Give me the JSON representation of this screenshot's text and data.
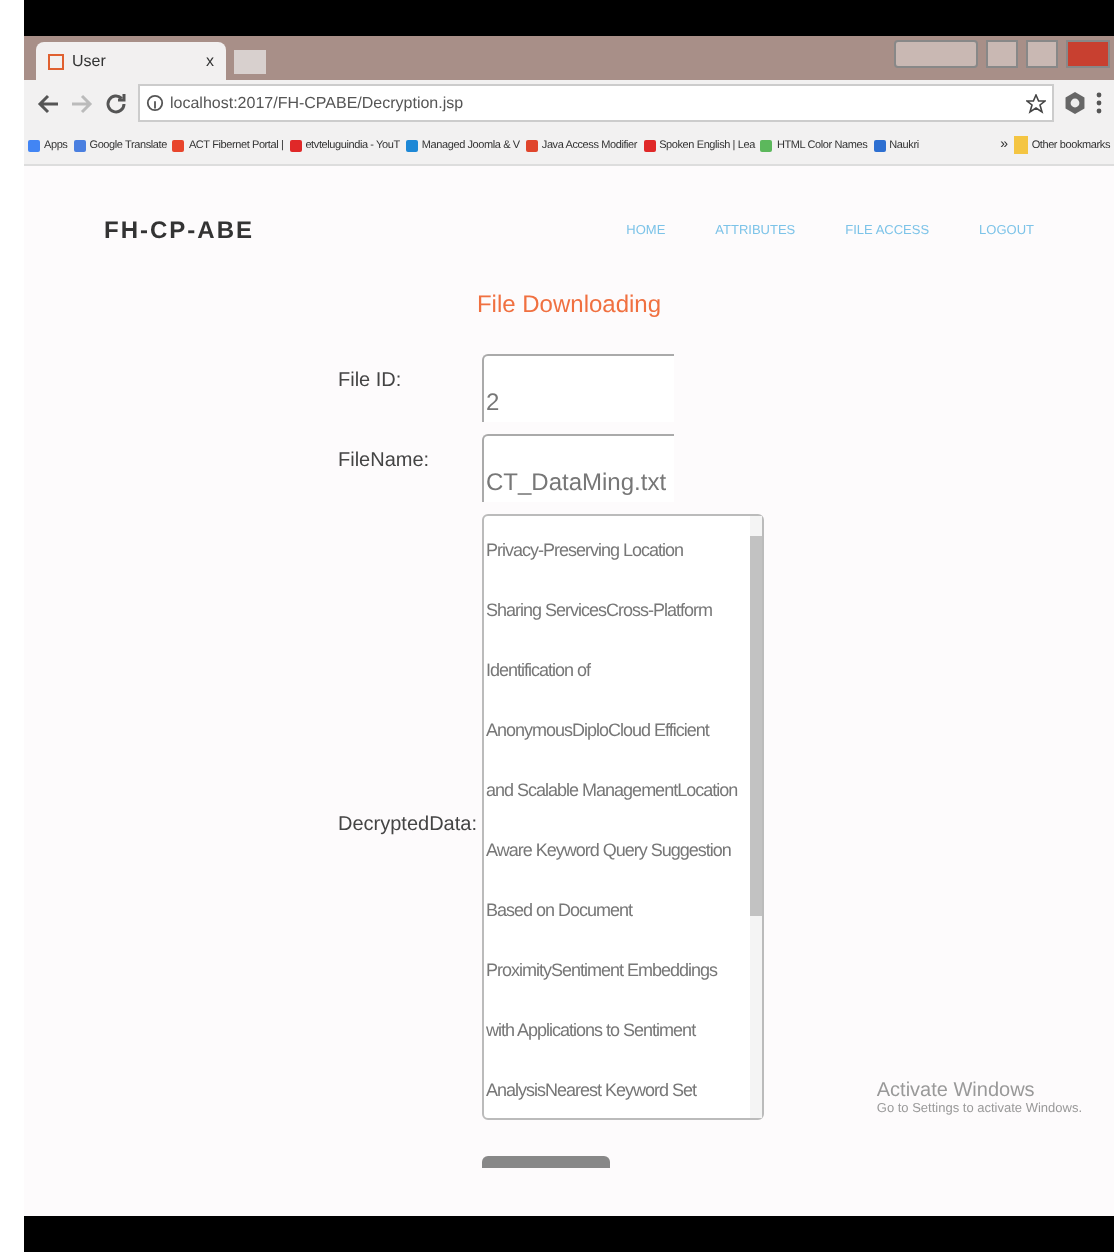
{
  "browser": {
    "tab": {
      "title": "User",
      "close": "x"
    },
    "address": "localhost:2017/FH-CPABE/Decryption.jsp",
    "bookmarks": [
      {
        "label": "Apps",
        "color": "#4285f4"
      },
      {
        "label": "Google Translate",
        "color": "#4a7fe0"
      },
      {
        "label": "ACT Fibernet Portal |",
        "color": "#e8452c"
      },
      {
        "label": "etvteluguindia - YouT",
        "color": "#e02828"
      },
      {
        "label": "Managed Joomla & V",
        "color": "#1e88d6"
      },
      {
        "label": "Java Access Modifier",
        "color": "#e0452c"
      },
      {
        "label": "Spoken English | Lea",
        "color": "#e02828"
      },
      {
        "label": "HTML Color Names",
        "color": "#5cb85c"
      },
      {
        "label": "Naukri",
        "color": "#2d6fd1"
      }
    ],
    "overflow": "»",
    "other_bookmarks": "Other bookmarks"
  },
  "site": {
    "logo": "FH-CP-ABE",
    "nav": [
      {
        "label": "HOME"
      },
      {
        "label": "ATTRIBUTES"
      },
      {
        "label": "FILE ACCESS"
      },
      {
        "label": "LOGOUT"
      }
    ]
  },
  "form": {
    "heading": "File Downloading",
    "fields": [
      {
        "label": "File ID:",
        "value": "2"
      },
      {
        "label": "FileName:",
        "value": "CT_DataMing.txt"
      }
    ],
    "data_label": "DecryptedData:",
    "data_lines": [
      "Privacy-Preserving Location",
      "Sharing ServicesCross-Platform",
      "Identification of",
      "AnonymousDiploCloud Efficient",
      "and Scalable ManagementLocation",
      "Aware Keyword Query Suggestion",
      "Based on Document",
      "ProximitySentiment Embeddings",
      "with Applications to Sentiment",
      "AnalysisNearest Keyword Set"
    ]
  },
  "activation": {
    "title": "Activate Windows",
    "subtitle": "Go to Settings to activate Windows."
  }
}
